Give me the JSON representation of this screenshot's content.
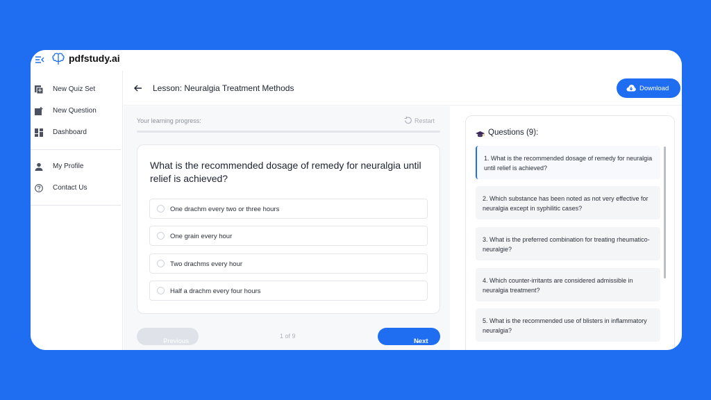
{
  "app": {
    "brand": "pdfstudy.ai"
  },
  "sidebar": {
    "items": [
      {
        "label": "New Quiz Set",
        "icon": "quiz-set-icon"
      },
      {
        "label": "New Question",
        "icon": "new-question-icon"
      },
      {
        "label": "Dashboard",
        "icon": "dashboard-icon"
      },
      {
        "label": "My Profile",
        "icon": "user-icon"
      },
      {
        "label": "Contact Us",
        "icon": "help-icon"
      }
    ]
  },
  "header": {
    "title": "Lesson: Neuralgia Treatment Methods",
    "download_label": "Download"
  },
  "progress": {
    "label": "Your learning progress:",
    "restart_label": "Restart",
    "fraction": 0
  },
  "question": {
    "text": "What is the recommended dosage of remedy for neuralgia until relief is achieved?",
    "options": [
      "One drachm every two or three hours",
      "One grain every hour",
      "Two drachms every hour",
      "Half a drachm every four hours"
    ]
  },
  "pagination": {
    "previous_label": "Previous",
    "indicator": "1 of 9",
    "next_label": "Next"
  },
  "questions_panel": {
    "title": "Questions (9):",
    "items": [
      "1. What is the recommended dosage of remedy for neuralgia until relief is achieved?",
      "2. Which substance has been noted as not very effective for neuralgia except in syphilitic cases?",
      "3. What is the preferred combination for treating rheumatico-neuralgie?",
      "4. Which counter-irritants are considered admissible in neuralgia treatment?",
      "5. What is the recommended use of blisters in inflammatory neuralgia?"
    ]
  },
  "colors": {
    "accent": "#1f6ef2",
    "background": "#1f6ef2"
  }
}
